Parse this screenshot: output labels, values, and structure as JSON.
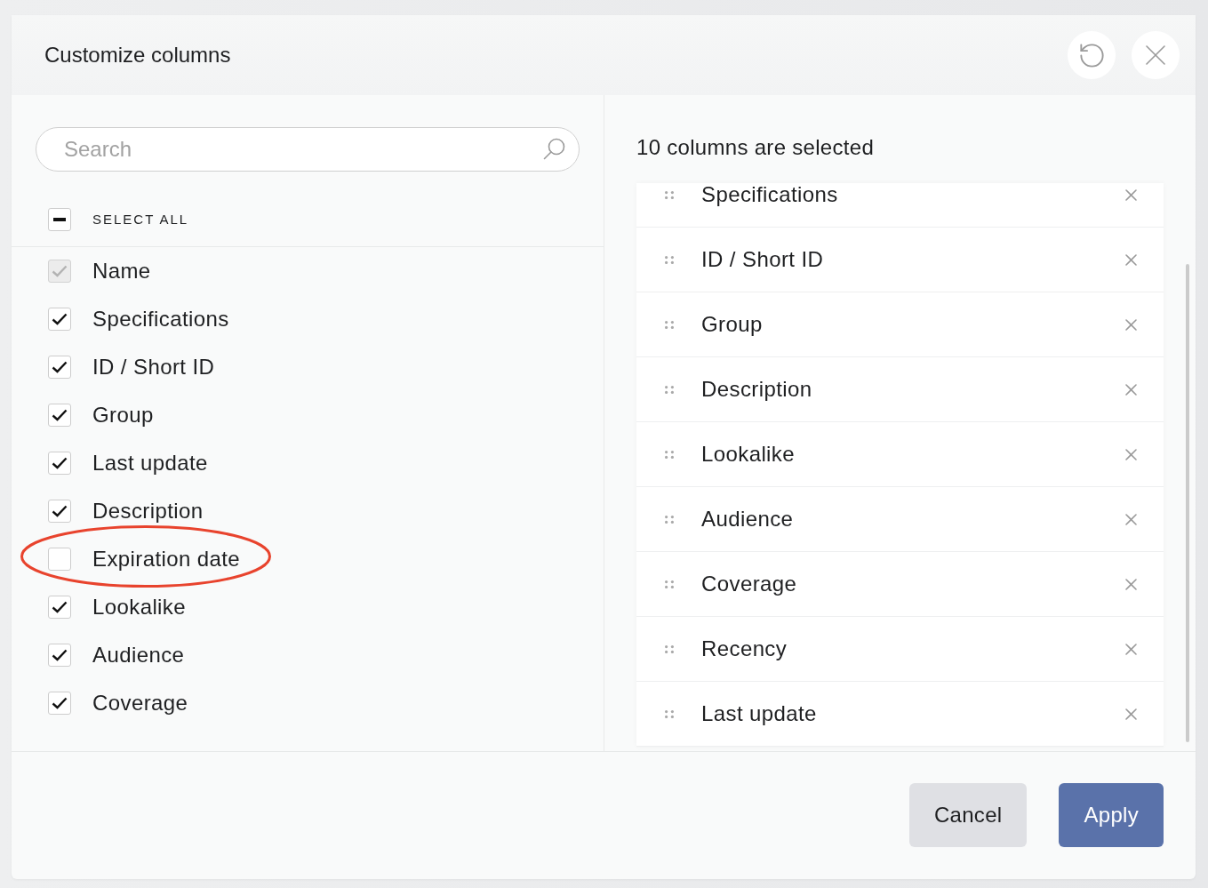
{
  "dialog": {
    "title": "Customize columns"
  },
  "search": {
    "placeholder": "Search"
  },
  "select_all": {
    "label": "SELECT ALL",
    "indeterminate": true
  },
  "available_columns": [
    {
      "label": "Name",
      "checked": true,
      "disabled": true,
      "highlighted": false
    },
    {
      "label": "Specifications",
      "checked": true,
      "disabled": false,
      "highlighted": false
    },
    {
      "label": "ID / Short ID",
      "checked": true,
      "disabled": false,
      "highlighted": false
    },
    {
      "label": "Group",
      "checked": true,
      "disabled": false,
      "highlighted": false
    },
    {
      "label": "Last update",
      "checked": true,
      "disabled": false,
      "highlighted": false
    },
    {
      "label": "Description",
      "checked": true,
      "disabled": false,
      "highlighted": false
    },
    {
      "label": "Expiration date",
      "checked": false,
      "disabled": false,
      "highlighted": true
    },
    {
      "label": "Lookalike",
      "checked": true,
      "disabled": false,
      "highlighted": false
    },
    {
      "label": "Audience",
      "checked": true,
      "disabled": false,
      "highlighted": false
    },
    {
      "label": "Coverage",
      "checked": true,
      "disabled": false,
      "highlighted": false
    }
  ],
  "selected_summary": "10 columns are selected",
  "selected_columns": [
    {
      "label": "Specifications"
    },
    {
      "label": "ID / Short ID"
    },
    {
      "label": "Group"
    },
    {
      "label": "Description"
    },
    {
      "label": "Lookalike"
    },
    {
      "label": "Audience"
    },
    {
      "label": "Coverage"
    },
    {
      "label": "Recency"
    },
    {
      "label": "Last update"
    }
  ],
  "buttons": [
    {
      "label": "Cancel",
      "kind": "secondary"
    },
    {
      "label": "Apply",
      "kind": "primary"
    }
  ]
}
